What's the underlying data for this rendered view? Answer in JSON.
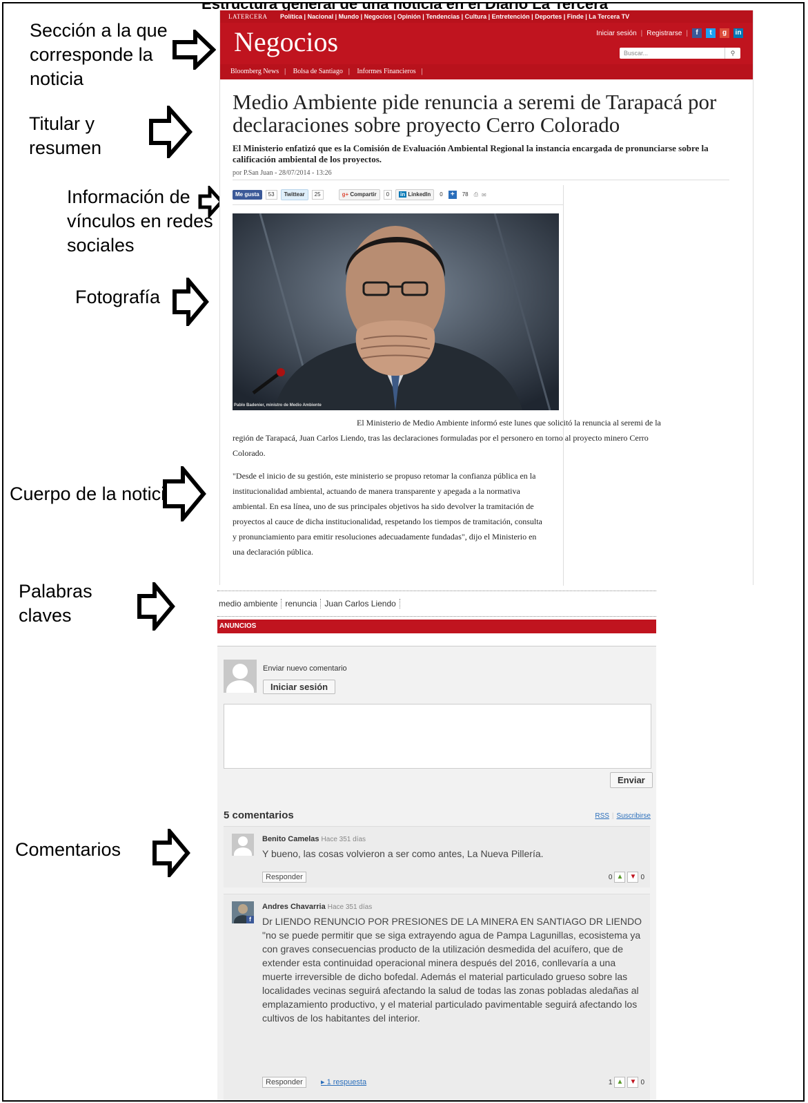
{
  "figure_title": "Estructura general de una noticia en el Diario La Tercera",
  "annotations": {
    "seccion": "Sección a la que corresponde la noticia",
    "titular": "Titular y resumen",
    "redes": "Información de vínculos en redes sociales",
    "foto": "Fotografía",
    "cuerpo": "Cuerpo de la noticia",
    "palabras": "Palabras claves",
    "comentarios": "Comentarios"
  },
  "site": {
    "brand": "LATERCERA",
    "topnav": [
      "Política",
      "Nacional",
      "Mundo",
      "Negocios",
      "Opinión",
      "Tendencias",
      "Cultura",
      "Entretención",
      "Deportes",
      "Finde",
      "La Tercera TV"
    ],
    "section": "Negocios",
    "login": "Iniciar sesión",
    "register": "Registrarse",
    "search_placeholder": "Buscar...",
    "subnav": [
      "Bloomberg News",
      "Bolsa de Santiago",
      "Informes Financieros"
    ]
  },
  "article": {
    "headline": "Medio Ambiente pide renuncia a seremi de Tarapacá por declaraciones sobre proyecto Cerro Colorado",
    "summary": "El Ministerio enfatizó que es la Comisión de Evaluación Ambiental Regional la instancia encargada de pronunciarse sobre la calificación ambiental de los proyectos.",
    "byline": "por P.San Juan - 28/07/2014 - 13:26",
    "share": {
      "like": "Me gusta",
      "like_count": "53",
      "tweet": "Twittear",
      "tweet_count": "25",
      "gplus": "Compartir",
      "gplus_count": "0",
      "linkedin": "LinkedIn",
      "linkedin_count": "0",
      "plus_count": "78"
    },
    "photo_caption": "Pablo Badenier, ministro de Medio Ambiente",
    "paragraph1": "El Ministerio de Medio Ambiente informó este lunes que solicitó la renuncia al seremi de la región de Tarapacá, Juan Carlos Liendo, tras las declaraciones formuladas por el personero en torno al proyecto minero Cerro Colorado.",
    "paragraph2": "\"Desde el inicio de su gestión, este ministerio se propuso retomar la confianza pública en la institucionalidad ambiental, actuando de manera transparente y apegada a la normativa ambiental. En esa línea, uno de sus principales objetivos ha sido devolver la tramitación de proyectos al cauce de dicha institucionalidad, respetando los tiempos de tramitación, consulta y pronunciamiento para emitir resoluciones adecuadamente fundadas\", dijo el Ministerio en una declaración pública."
  },
  "tags": [
    "medio ambiente",
    "renuncia",
    "Juan Carlos Liendo"
  ],
  "ads_label": "ANUNCIOS",
  "comments": {
    "new_label": "Enviar nuevo comentario",
    "login_button": "Iniciar sesión",
    "send_button": "Enviar",
    "count_label": "5 comentarios",
    "rss": "RSS",
    "subscribe": "Suscribirse",
    "items": [
      {
        "author": "Benito Camelas",
        "time": "Hace 351 días",
        "text": "Y bueno, las cosas volvieron a ser como antes, La Nueva Pillería.",
        "reply": "Responder",
        "up": "0",
        "down": "0"
      },
      {
        "author": "Andres Chavarria",
        "time": "Hace 351 días",
        "text": "Dr LIENDO RENUNCIO POR PRESIONES DE LA MINERA EN SANTIAGO DR LIENDO \"no se puede permitir que se siga extrayendo agua de Pampa Lagunillas, ecosistema ya con graves consecuencias producto de la utilización desmedida del acuífero, que de extender esta continuidad operacional minera después del 2016, conllevaría a una muerte irreversible de dicho bofedal. Además el material particulado grueso sobre las localidades vecinas seguirá afectando la salud de todas las zonas pobladas aledañas al emplazamiento productivo, y el material particulado pavimentable seguirá afectando los cultivos de los habitantes del interior.",
        "reply": "Responder",
        "replies": "1 respuesta",
        "up": "1",
        "down": "0"
      }
    ]
  },
  "colors": {
    "brand_red": "#c0141f",
    "link_blue": "#2a6ebb"
  }
}
